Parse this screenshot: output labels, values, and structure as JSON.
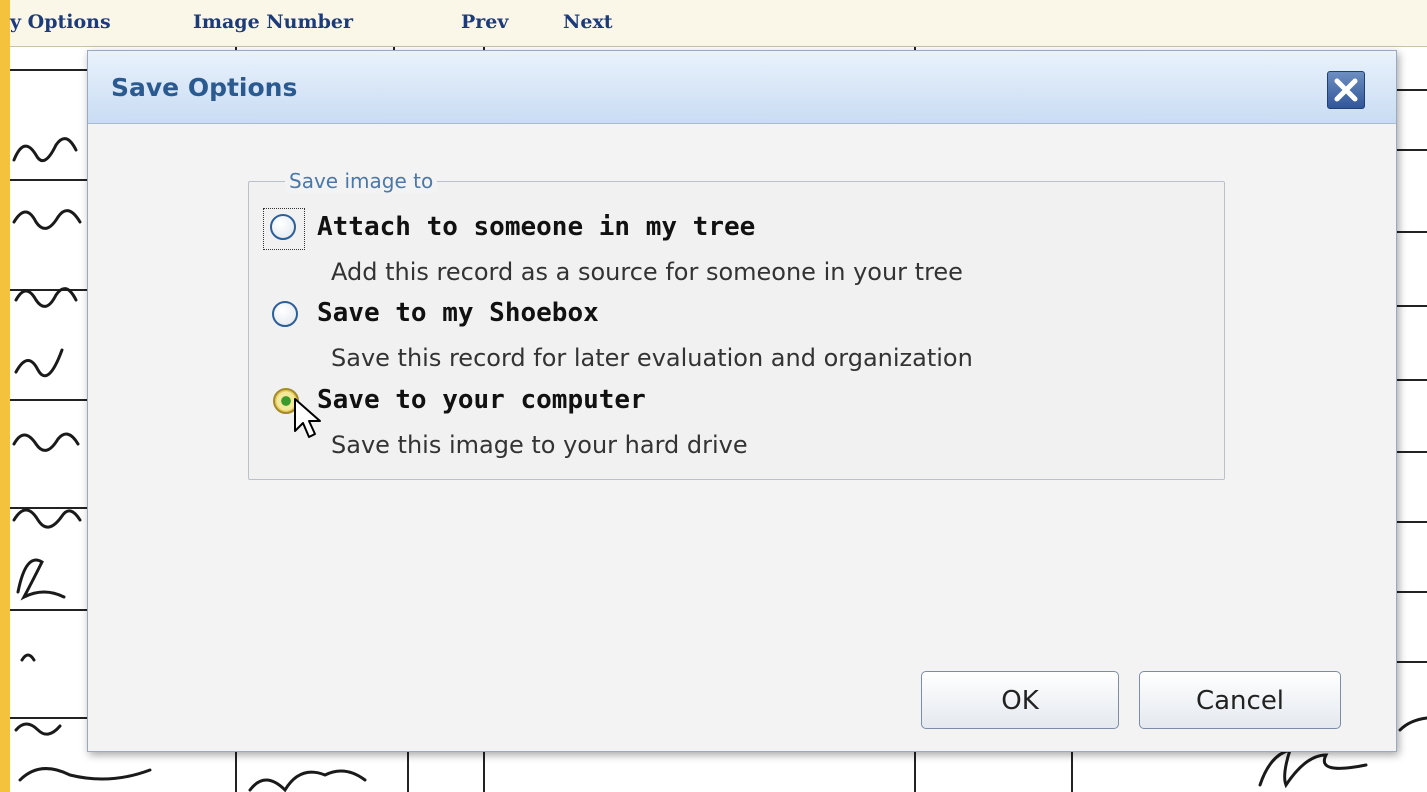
{
  "toolbar": {
    "items": [
      "y Options",
      "Image Number",
      "Prev",
      "Next"
    ]
  },
  "dialog": {
    "title": "Save Options",
    "close_icon": "close-icon",
    "group_legend": "Save image to",
    "options": [
      {
        "label": "Attach to someone in my tree",
        "description": "Add this record as a source for someone in your tree",
        "selected": false,
        "focused": true
      },
      {
        "label": "Save to my Shoebox",
        "description": "Save this record for later evaluation and organization",
        "selected": false,
        "focused": false
      },
      {
        "label": "Save to your computer",
        "description": "Save this image to your hard drive",
        "selected": true,
        "focused": false
      }
    ],
    "ok_label": "OK",
    "cancel_label": "Cancel"
  },
  "colors": {
    "accent_strip": "#f5c23e",
    "toolbar_link": "#1c3b7a",
    "title_text": "#2a5a8f",
    "legend_text": "#4b78a8"
  }
}
